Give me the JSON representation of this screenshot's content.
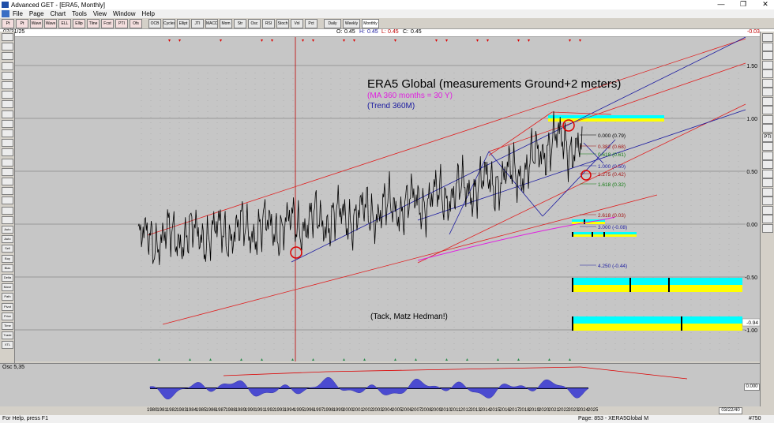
{
  "window": {
    "title": "Advanced GET - [ERA5, Monthly]",
    "minimize": "—",
    "restore": "❐",
    "close": "✕"
  },
  "menu": [
    "File",
    "Page",
    "Chart",
    "Tools",
    "View",
    "Window",
    "Help"
  ],
  "toolbar": {
    "buttons": [
      "Pt",
      "Pt",
      "Wave",
      "Wave",
      "ELL",
      "Ellip",
      "Tline",
      "Fcst",
      "PTI",
      "Ofs",
      "OCB",
      "Cycles",
      "Ellipt",
      "JTI",
      "MACD",
      "Mom",
      "Str",
      "Osc",
      "RSI",
      "Stoch",
      "Vol",
      "Pct",
      "Daily",
      "Weekly",
      "Monthly"
    ],
    "selected": "Monthly"
  },
  "header": {
    "date": "07/31/25",
    "ohlc": {
      "o_label": "O:",
      "o": "0.45",
      "h_label": "H:",
      "h": "0.45",
      "l_label": "L:",
      "l": "0.45",
      "c_label": "C:",
      "c": "0.45"
    },
    "change": "-0.03"
  },
  "chart": {
    "title": "ERA5 Global (measurements Ground+2 meters)",
    "legend_ma": "(MA 360 months = 30 Y)",
    "legend_trend": "(Trend 360M)",
    "credit": "(Tack, Matz Hedman!)",
    "colors": {
      "price": "#000000",
      "channel": "#e02020",
      "trend": "#1a1aa0",
      "ma": "#e020e0",
      "fib_red": "#a01010",
      "fib_green": "#107a10",
      "cyan": "#00ffff",
      "yellow": "#ffff00"
    },
    "y_ticks": [
      "1.50",
      "1.00",
      "0.50",
      "0.00",
      "-0.50",
      "-1.00"
    ],
    "last_value_label": "-0.94",
    "fib_levels": [
      {
        "label": "0.000 (0.79)",
        "color": "#000000"
      },
      {
        "label": "0.382 (0.68)",
        "color": "#a01010"
      },
      {
        "label": "0.618 (0.61)",
        "color": "#107a10"
      },
      {
        "label": "1.000 (0.50)",
        "color": "#1a1aa0"
      },
      {
        "label": "1.275 (0.42)",
        "color": "#a01010"
      },
      {
        "label": "1.618 (0.32)",
        "color": "#107a10"
      },
      {
        "label": "2.618 (0.03)",
        "color": "#a01010"
      },
      {
        "label": "3.000 (-0.08)",
        "color": "#1a1aa0"
      },
      {
        "label": "4.250 (-0.44)",
        "color": "#1a1aa0"
      }
    ]
  },
  "osc": {
    "label": "Osc 5,35",
    "zero_label": "0.000"
  },
  "xaxis": {
    "years": [
      "1980",
      "1981",
      "1982",
      "1983",
      "1984",
      "1985",
      "1986",
      "1987",
      "1988",
      "1989",
      "1990",
      "1991",
      "1992",
      "1993",
      "1994",
      "1995",
      "1996",
      "1997",
      "1998",
      "1999",
      "2000",
      "2001",
      "2002",
      "2003",
      "2004",
      "2005",
      "2006",
      "2007",
      "2008",
      "2009",
      "2010",
      "2011",
      "2012",
      "2013",
      "2014",
      "2015",
      "2016",
      "2017",
      "2018",
      "2019",
      "2020",
      "2021",
      "2022",
      "2023",
      "2024",
      "2025"
    ],
    "end_date": "03/22/40"
  },
  "status": {
    "help": "For Help, press F1",
    "page": "Page: 853 - XERA5Global M",
    "id": "#750"
  },
  "leftbar": [
    "",
    "",
    "",
    "",
    "",
    "",
    "",
    "",
    "",
    "",
    "",
    "",
    "",
    "",
    "",
    "",
    "",
    "",
    "",
    "",
    "Auto Gann",
    "Auto Trend",
    "Sell Bank",
    "Buy Bank",
    "Bias",
    "Delta",
    "Move Arm",
    "Path Reg",
    "Pivot",
    "Price Cross",
    "Time Cross",
    "Trade Profile",
    "XTL"
  ],
  "rightbar": [
    "",
    "",
    "",
    "",
    "",
    "",
    "",
    "",
    "",
    "",
    "",
    "PTI",
    "",
    "",
    "",
    "",
    "",
    "",
    "",
    "",
    "",
    ""
  ]
}
